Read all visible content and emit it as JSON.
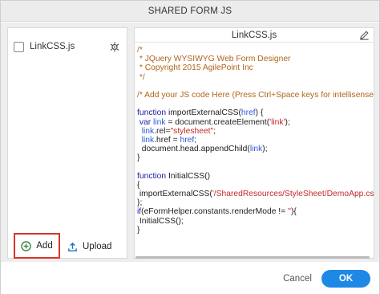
{
  "dialog": {
    "title": "SHARED FORM JS"
  },
  "left_panel": {
    "files": [
      {
        "name": "LinkCSS.js",
        "checked": false,
        "icon": "settings-bug-icon"
      }
    ],
    "add_label": "Add",
    "add_icon": "plus-circle-icon",
    "upload_label": "Upload",
    "upload_icon": "upload-icon"
  },
  "editor": {
    "file_title": "LinkCSS.js",
    "edit_icon": "pencil-icon",
    "code_lines": [
      [
        {
          "t": "/*",
          "c": "comment"
        }
      ],
      [
        {
          "t": " * JQuery WYSIWYG Web Form Designer",
          "c": "comment"
        }
      ],
      [
        {
          "t": " * Copyright 2015 AgilePoint Inc",
          "c": "comment"
        }
      ],
      [
        {
          "t": " */",
          "c": "comment"
        }
      ],
      [],
      [
        {
          "t": "/* Add your JS code Here (Press Ctrl+Space keys for intellisense)",
          "c": "comment"
        }
      ],
      [],
      [
        {
          "t": "function ",
          "c": "keyword"
        },
        {
          "t": "importExternalCSS(",
          "c": "plain"
        },
        {
          "t": "href",
          "c": "var"
        },
        {
          "t": ") {",
          "c": "plain"
        }
      ],
      [
        {
          "t": " ",
          "c": "plain"
        },
        {
          "t": "var ",
          "c": "keyword"
        },
        {
          "t": "link",
          "c": "var"
        },
        {
          "t": " = document.createElement(",
          "c": "plain"
        },
        {
          "t": "'link'",
          "c": "string"
        },
        {
          "t": ");",
          "c": "plain"
        }
      ],
      [
        {
          "t": "  ",
          "c": "plain"
        },
        {
          "t": "link",
          "c": "var"
        },
        {
          "t": ".rel=",
          "c": "plain"
        },
        {
          "t": "\"stylesheet\"",
          "c": "string"
        },
        {
          "t": ";",
          "c": "plain"
        }
      ],
      [
        {
          "t": "  ",
          "c": "plain"
        },
        {
          "t": "link",
          "c": "var"
        },
        {
          "t": ".href = ",
          "c": "plain"
        },
        {
          "t": "href",
          "c": "var"
        },
        {
          "t": ";",
          "c": "plain"
        }
      ],
      [
        {
          "t": "  document.head.appendChild(",
          "c": "plain"
        },
        {
          "t": "link",
          "c": "var"
        },
        {
          "t": ");",
          "c": "plain"
        }
      ],
      [
        {
          "t": "}",
          "c": "plain"
        }
      ],
      [],
      [
        {
          "t": "function ",
          "c": "keyword"
        },
        {
          "t": "InitialCSS()",
          "c": "plain"
        }
      ],
      [
        {
          "t": "{",
          "c": "plain"
        }
      ],
      [
        {
          "t": " importExternalCSS(",
          "c": "plain"
        },
        {
          "t": "'/SharedResources/StyleSheet/DemoApp.css'",
          "c": "string"
        },
        {
          "t": ");",
          "c": "plain"
        }
      ],
      [
        {
          "t": "};",
          "c": "plain"
        }
      ],
      [
        {
          "t": "if",
          "c": "keyword"
        },
        {
          "t": "(eFormHelper.constants.renderMode != ",
          "c": "plain"
        },
        {
          "t": "''",
          "c": "string"
        },
        {
          "t": "){",
          "c": "plain"
        }
      ],
      [
        {
          "t": " InitialCSS();",
          "c": "plain"
        }
      ],
      [
        {
          "t": "}",
          "c": "plain"
        }
      ]
    ]
  },
  "footer": {
    "cancel_label": "Cancel",
    "ok_label": "OK"
  },
  "colors": {
    "comment": "#b0651a",
    "keyword": "#1a1aa6",
    "var": "#2a5bd7",
    "string": "#c22a2a",
    "plain": "#222222",
    "accent": "#1e88e5",
    "highlight_border": "#d9342b"
  }
}
